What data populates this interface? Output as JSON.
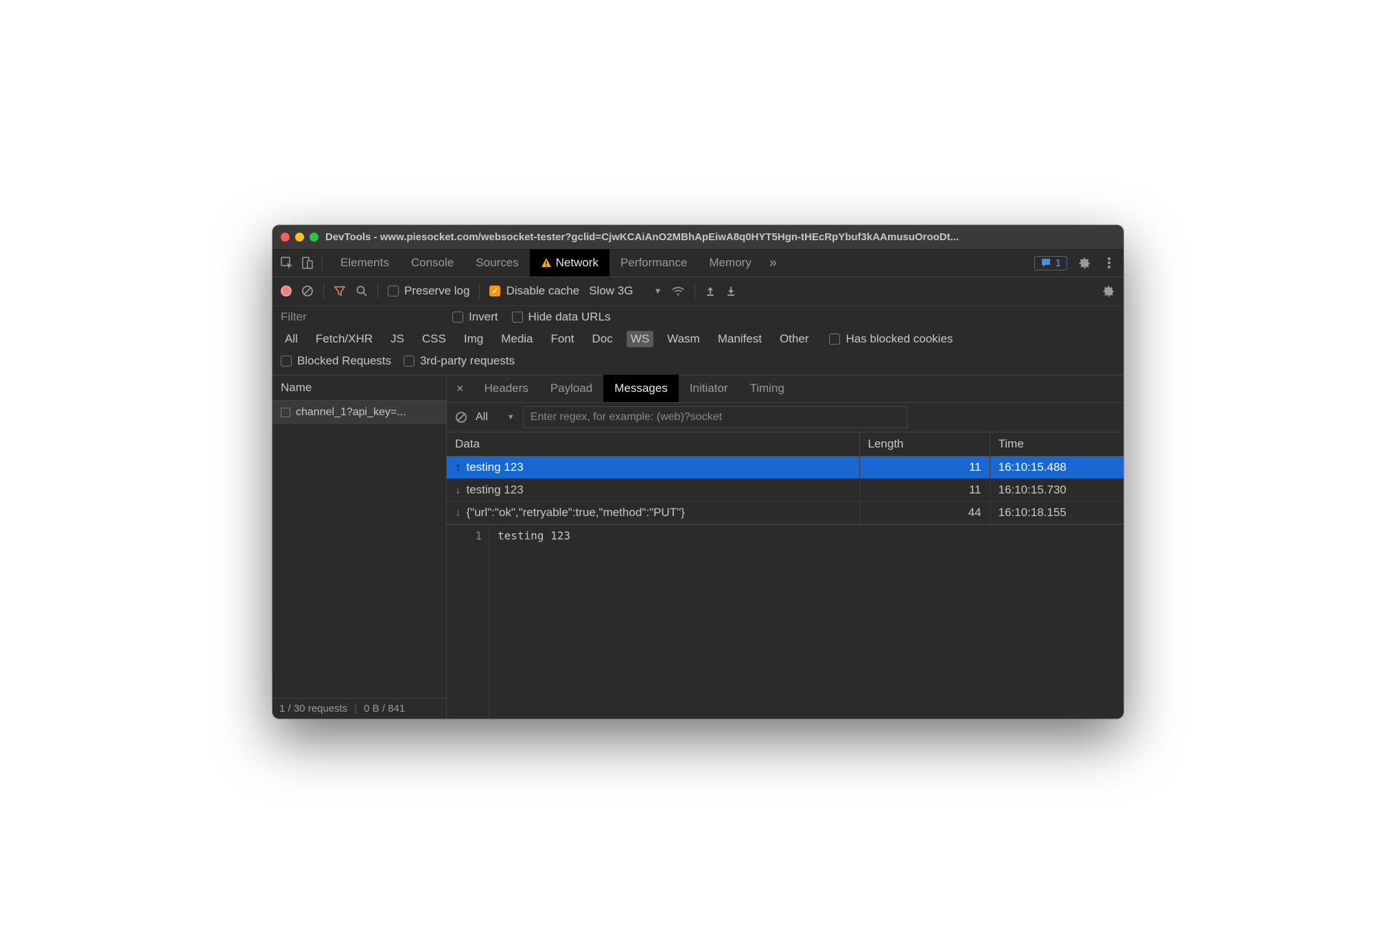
{
  "titlebar": {
    "title": "DevTools - www.piesocket.com/websocket-tester?gclid=CjwKCAiAnO2MBhApEiwA8q0HYT5Hgn-tHEcRpYbuf3kAAmusuOrooDt..."
  },
  "panelTabs": {
    "elements": "Elements",
    "console": "Console",
    "sources": "Sources",
    "network": "Network",
    "performance": "Performance",
    "memory": "Memory"
  },
  "issues": {
    "count": "1"
  },
  "networkToolbar": {
    "preserveLog": "Preserve log",
    "disableCache": "Disable cache",
    "throttling": "Slow 3G"
  },
  "filterBar": {
    "placeholder": "Filter",
    "invert": "Invert",
    "hideDataUrls": "Hide data URLs",
    "types": {
      "all": "All",
      "fetchxhr": "Fetch/XHR",
      "js": "JS",
      "css": "CSS",
      "img": "Img",
      "media": "Media",
      "font": "Font",
      "doc": "Doc",
      "ws": "WS",
      "wasm": "Wasm",
      "manifest": "Manifest",
      "other": "Other"
    },
    "hasBlockedCookies": "Has blocked cookies",
    "blockedRequests": "Blocked Requests",
    "thirdParty": "3rd-party requests"
  },
  "sidebar": {
    "nameHeader": "Name",
    "requests": [
      {
        "name": "channel_1?api_key=..."
      }
    ],
    "footer": {
      "requests": "1 / 30 requests",
      "bytes": "0 B / 841"
    }
  },
  "detailTabs": {
    "headers": "Headers",
    "payload": "Payload",
    "messages": "Messages",
    "initiator": "Initiator",
    "timing": "Timing"
  },
  "messageToolbar": {
    "all": "All",
    "regexPlaceholder": "Enter regex, for example: (web)?socket"
  },
  "messageTable": {
    "headers": {
      "data": "Data",
      "length": "Length",
      "time": "Time"
    },
    "rows": [
      {
        "dir": "up",
        "data": "testing 123",
        "length": "11",
        "time": "16:10:15.488",
        "selected": true
      },
      {
        "dir": "down",
        "data": "testing 123",
        "length": "11",
        "time": "16:10:15.730",
        "selected": false
      },
      {
        "dir": "down",
        "data": "{\"url\":\"ok\",\"retryable\":true,\"method\":\"PUT\"}",
        "length": "44",
        "time": "16:10:18.155",
        "selected": false
      }
    ]
  },
  "preview": {
    "lineno": "1",
    "body": "testing 123"
  }
}
